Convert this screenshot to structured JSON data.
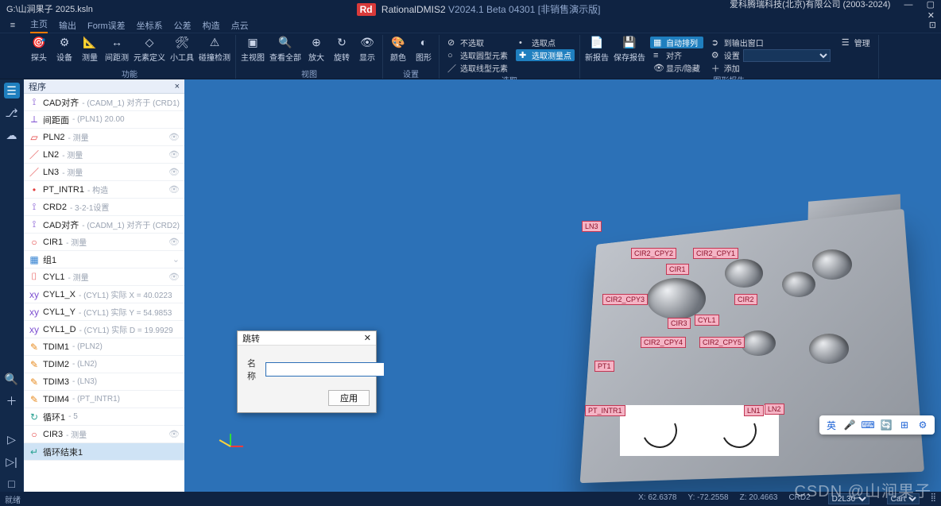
{
  "title": {
    "file": "G:\\山涧果子 2025.ksln",
    "app": "RationalDMIS2",
    "ver": "V2024.1 Beta 04301 [非销售演示版]",
    "company": "爱科腾瑞科技(北京)有限公司 (2003-2024)"
  },
  "menu": {
    "hamb": "≡",
    "tabs": [
      "主页",
      "输出",
      "Form误差",
      "坐标系",
      "公差",
      "构造",
      "点云"
    ]
  },
  "ribbon": {
    "fn": {
      "label": "功能",
      "items": [
        "探头",
        "设备",
        "测量",
        "间距测",
        "元素定义",
        "小工具",
        "碰撞检测"
      ]
    },
    "view": {
      "label": "视图",
      "items": [
        "主视图",
        "查看全部",
        "放大",
        "旋转",
        "显示"
      ]
    },
    "set": {
      "label": "设置",
      "items": [
        "颜色",
        "图形"
      ]
    },
    "sel": {
      "label": "选取",
      "a": "不选取",
      "b": "选取圆型元素",
      "c": "选取线型元素",
      "d": "选取点",
      "e": "选取测量点"
    },
    "rpt": {
      "label": "图形报告",
      "n": "新报告",
      "s": "保存报告",
      "auto": "自动排列",
      "align": "对齐",
      "show": "显示/隐藏",
      "out": "到输出窗口",
      "mgr": "管理",
      "add": "添加",
      "cfg": "设置"
    }
  },
  "panel": {
    "title": "程序",
    "close": "×"
  },
  "program": [
    {
      "ico": "⟟",
      "c": "i-purple",
      "main": "CAD对齐",
      "sub": "- (CADM_1) 对齐于 (CRD1)"
    },
    {
      "ico": "⟂",
      "c": "i-purple",
      "main": "间距面",
      "sub": "- (PLN1) 20.00"
    },
    {
      "ico": "▱",
      "c": "i-red",
      "main": "PLN2",
      "sub": "- 测量",
      "eye": true
    },
    {
      "ico": "／",
      "c": "i-red",
      "main": "LN2",
      "sub": "- 测量",
      "eye": true
    },
    {
      "ico": "／",
      "c": "i-red",
      "main": "LN3",
      "sub": "- 测量",
      "eye": true
    },
    {
      "ico": "•",
      "c": "i-red",
      "main": "PT_INTR1",
      "sub": "- 构造",
      "eye": true
    },
    {
      "ico": "⟟",
      "c": "i-purple",
      "main": "CRD2",
      "sub": "- 3-2-1设置"
    },
    {
      "ico": "⟟",
      "c": "i-purple",
      "main": "CAD对齐",
      "sub": "- (CADM_1) 对齐于 (CRD2)"
    },
    {
      "ico": "○",
      "c": "i-red",
      "main": "CIR1",
      "sub": "- 测量",
      "eye": true
    },
    {
      "ico": "▦",
      "c": "i-blue",
      "main": "组1",
      "sub": "",
      "chev": true
    },
    {
      "ico": "⌷",
      "c": "i-red",
      "main": "CYL1",
      "sub": "- 测量",
      "eye": true
    },
    {
      "ico": "xy",
      "c": "i-purple",
      "main": "CYL1_X",
      "sub": "- (CYL1) 实际 X = 40.0223"
    },
    {
      "ico": "xy",
      "c": "i-purple",
      "main": "CYL1_Y",
      "sub": "- (CYL1) 实际 Y = 54.9853"
    },
    {
      "ico": "xy",
      "c": "i-purple",
      "main": "CYL1_D",
      "sub": "- (CYL1) 实际 D = 19.9929"
    },
    {
      "ico": "✎",
      "c": "i-orange",
      "main": "TDIM1",
      "sub": "- (PLN2)"
    },
    {
      "ico": "✎",
      "c": "i-orange",
      "main": "TDIM2",
      "sub": "- (LN2)"
    },
    {
      "ico": "✎",
      "c": "i-orange",
      "main": "TDIM3",
      "sub": "- (LN3)"
    },
    {
      "ico": "✎",
      "c": "i-orange",
      "main": "TDIM4",
      "sub": "- (PT_INTR1)"
    },
    {
      "ico": "↻",
      "c": "i-teal",
      "main": "循环1",
      "sub": "- 5"
    },
    {
      "ico": "○",
      "c": "i-red",
      "main": "CIR3",
      "sub": "- 测量",
      "eye": true
    },
    {
      "ico": "↵",
      "c": "i-teal",
      "main": "循环结束1",
      "sub": "",
      "sel": true
    }
  ],
  "labels": [
    "LN3",
    "CIR2_CPY2",
    "CIR2_CPY1",
    "CIR1",
    "CIR2_CPY3",
    "CIR2",
    "CIR3",
    "CYL1",
    "CIR2_CPY4",
    "CIR2_CPY5",
    "PT1",
    "PT_INTR1",
    "LN1",
    "LN2"
  ],
  "dialog": {
    "title": "跳转",
    "name": "名称",
    "apply": "应用",
    "close": "✕",
    "value": ""
  },
  "status": {
    "ready": "就绪",
    "x": "X: 62.6378",
    "y": "Y: -72.2558",
    "z": "Z: 20.4663",
    "crd": "CRD2",
    "d": "D2L30",
    "cart": "Cart"
  },
  "watermark": "CSDN @山涧果子",
  "ime": [
    "英",
    "🎤",
    "⌨",
    "🔄",
    "⊞",
    "⚙"
  ]
}
